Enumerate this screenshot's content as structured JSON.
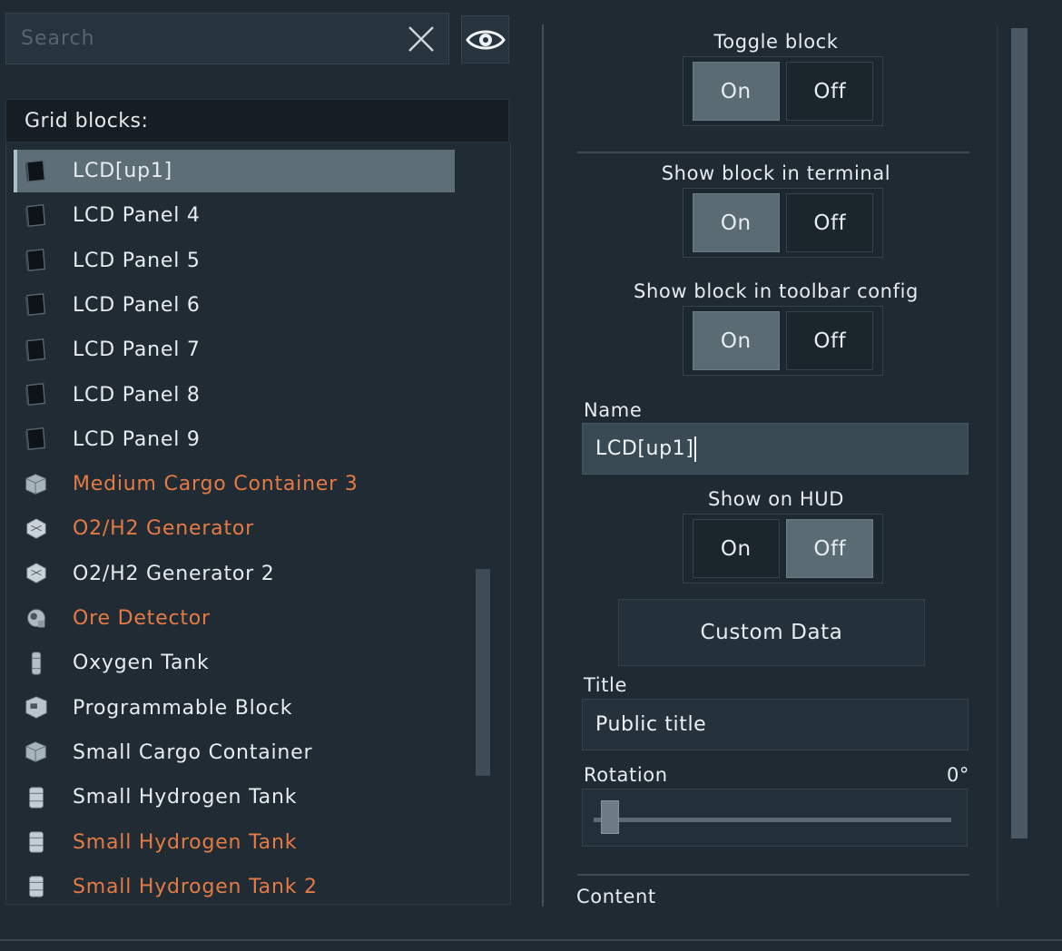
{
  "search": {
    "placeholder": "Search",
    "value": ""
  },
  "grid": {
    "header": "Grid blocks:",
    "items": [
      {
        "label": "LCD[up1]",
        "icon": "lcd-panel-icon",
        "selected": true,
        "warning": false
      },
      {
        "label": "LCD Panel 4",
        "icon": "lcd-panel-icon",
        "selected": false,
        "warning": false
      },
      {
        "label": "LCD Panel 5",
        "icon": "lcd-panel-icon",
        "selected": false,
        "warning": false
      },
      {
        "label": "LCD Panel 6",
        "icon": "lcd-panel-icon",
        "selected": false,
        "warning": false
      },
      {
        "label": "LCD Panel 7",
        "icon": "lcd-panel-icon",
        "selected": false,
        "warning": false
      },
      {
        "label": "LCD Panel 8",
        "icon": "lcd-panel-icon",
        "selected": false,
        "warning": false
      },
      {
        "label": "LCD Panel 9",
        "icon": "lcd-panel-icon",
        "selected": false,
        "warning": false
      },
      {
        "label": "Medium Cargo Container 3",
        "icon": "cargo-container-icon",
        "selected": false,
        "warning": true
      },
      {
        "label": "O2/H2 Generator",
        "icon": "generator-icon",
        "selected": false,
        "warning": true
      },
      {
        "label": "O2/H2 Generator 2",
        "icon": "generator-icon",
        "selected": false,
        "warning": false
      },
      {
        "label": "Ore Detector",
        "icon": "ore-detector-icon",
        "selected": false,
        "warning": true
      },
      {
        "label": "Oxygen Tank",
        "icon": "oxygen-tank-icon",
        "selected": false,
        "warning": false
      },
      {
        "label": "Programmable Block",
        "icon": "programmable-block-icon",
        "selected": false,
        "warning": false
      },
      {
        "label": "Small Cargo Container",
        "icon": "cargo-container-icon",
        "selected": false,
        "warning": false
      },
      {
        "label": "Small Hydrogen Tank",
        "icon": "hydrogen-tank-icon",
        "selected": false,
        "warning": false
      },
      {
        "label": "Small Hydrogen Tank",
        "icon": "hydrogen-tank-icon",
        "selected": false,
        "warning": true
      },
      {
        "label": "Small Hydrogen Tank 2",
        "icon": "hydrogen-tank-icon",
        "selected": false,
        "warning": true
      }
    ]
  },
  "properties": {
    "toggle_block": {
      "label": "Toggle block",
      "on": "On",
      "off": "Off",
      "value": "on"
    },
    "show_terminal": {
      "label": "Show block in terminal",
      "on": "On",
      "off": "Off",
      "value": "on"
    },
    "show_toolbar": {
      "label": "Show block in toolbar config",
      "on": "On",
      "off": "Off",
      "value": "on"
    },
    "name": {
      "label": "Name",
      "value": "LCD[up1]"
    },
    "show_hud": {
      "label": "Show on HUD",
      "on": "On",
      "off": "Off",
      "value": "off"
    },
    "custom_data_label": "Custom Data",
    "title": {
      "label": "Title",
      "value": "Public title"
    },
    "rotation": {
      "label": "Rotation",
      "value": "0°",
      "fraction": 0.0
    },
    "content_label": "Content"
  },
  "colors": {
    "warning": "#e57a45",
    "active": "#5a6b74",
    "background": "#1f2a33"
  }
}
